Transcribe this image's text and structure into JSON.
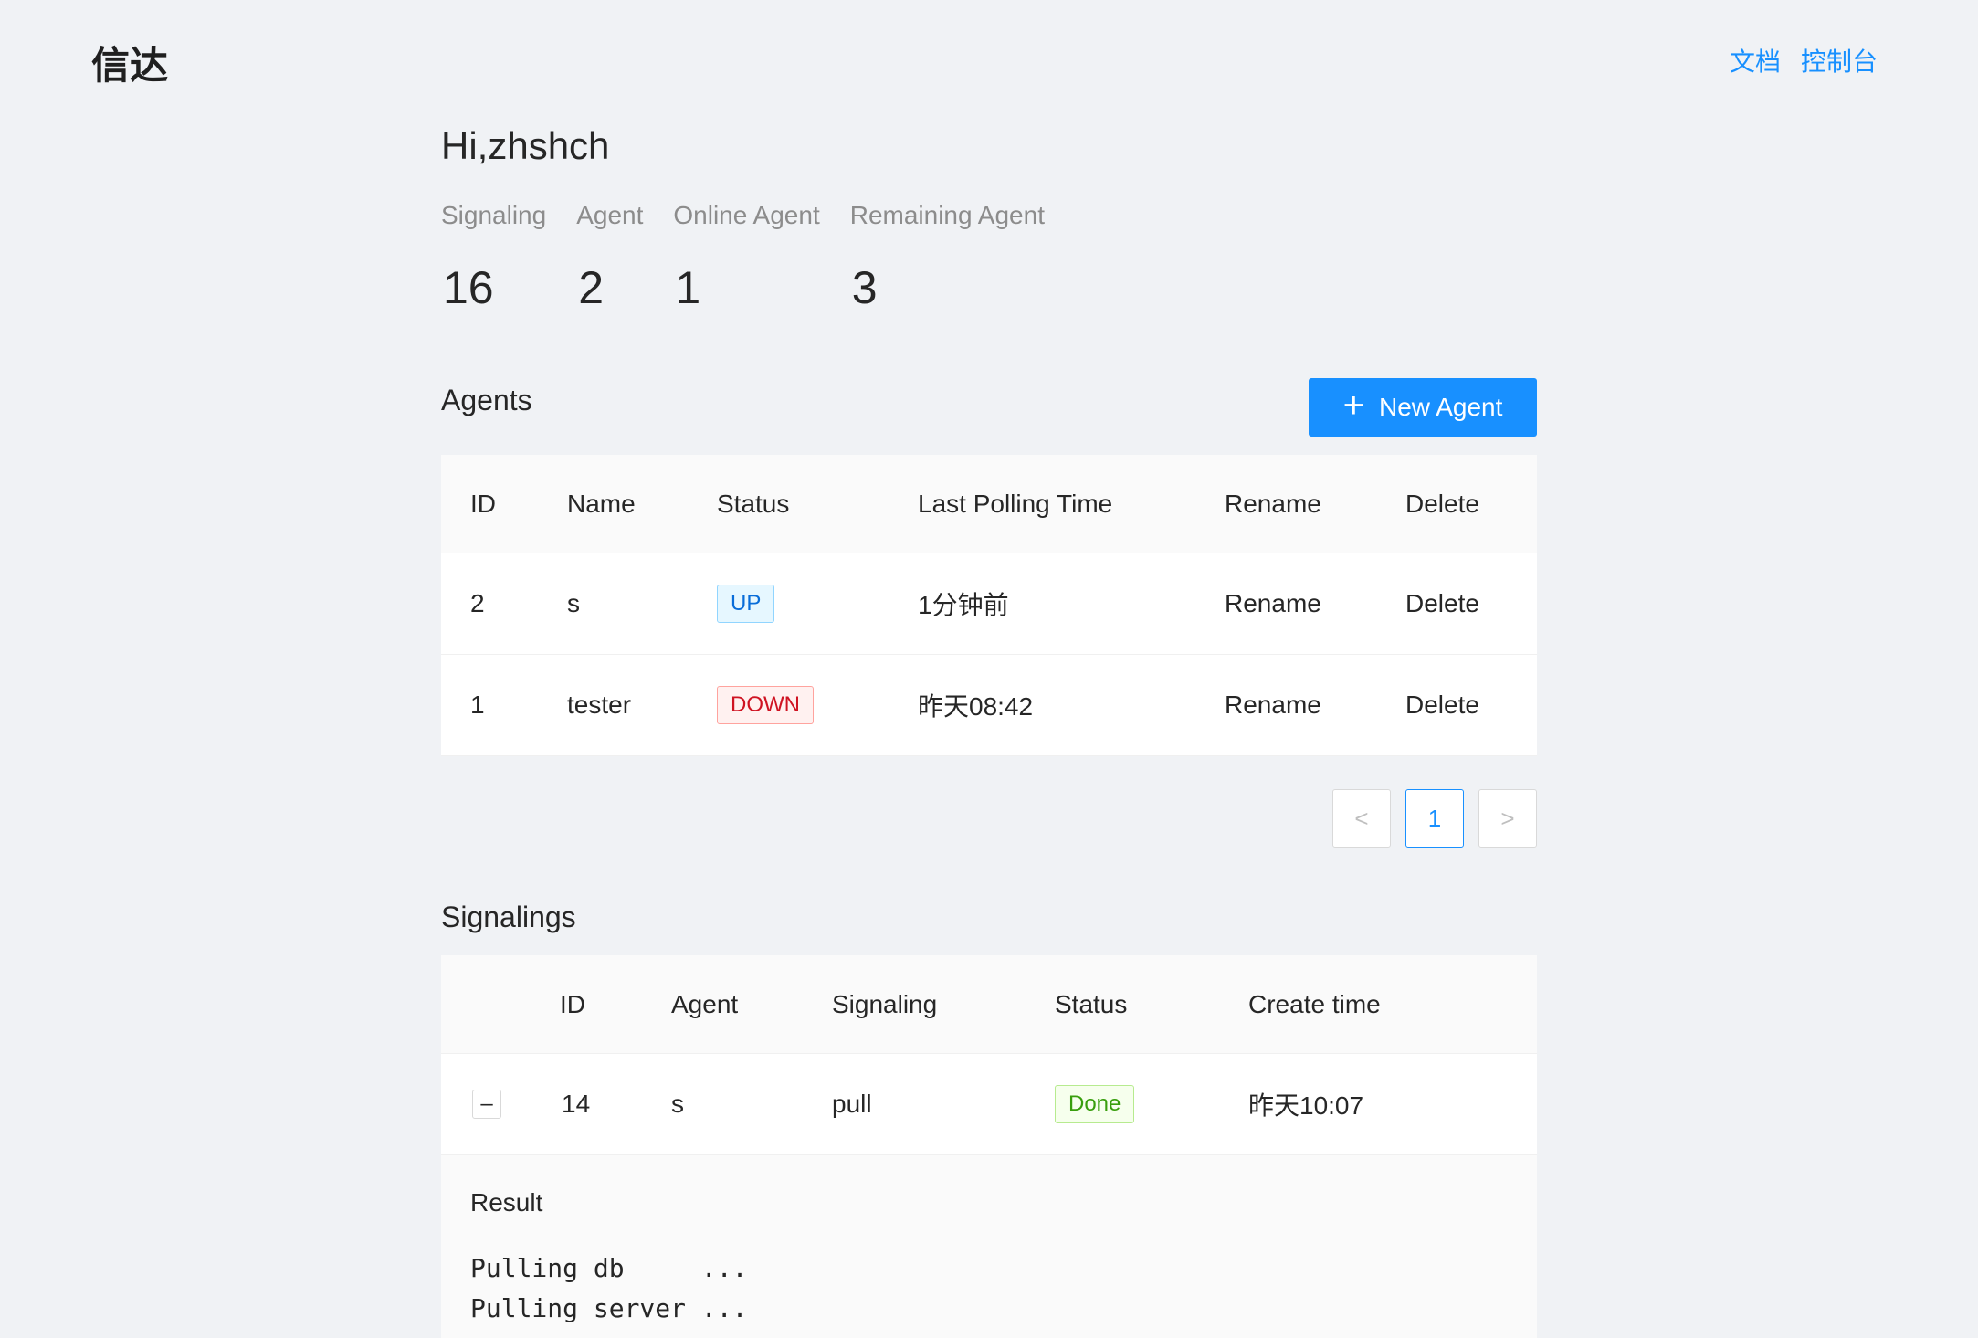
{
  "header": {
    "brand": "信达",
    "nav": [
      "文档",
      "控制台"
    ]
  },
  "greeting": "Hi,zhshch",
  "stats": [
    {
      "label": "Signaling",
      "value": "16"
    },
    {
      "label": "Agent",
      "value": "2"
    },
    {
      "label": "Online Agent",
      "value": "1"
    },
    {
      "label": "Remaining Agent",
      "value": "3"
    }
  ],
  "agents": {
    "title": "Agents",
    "new_button": "New Agent",
    "columns": [
      "ID",
      "Name",
      "Status",
      "Last Polling Time",
      "Rename",
      "Delete"
    ],
    "rows": [
      {
        "id": "2",
        "name": "s",
        "status": "UP",
        "last_polling": "1分钟前",
        "rename": "Rename",
        "delete": "Delete"
      },
      {
        "id": "1",
        "name": "tester",
        "status": "DOWN",
        "last_polling": "昨天08:42",
        "rename": "Rename",
        "delete": "Delete"
      }
    ],
    "pagination": {
      "prev": "<",
      "current": "1",
      "next": ">"
    }
  },
  "signalings": {
    "title": "Signalings",
    "columns": [
      "ID",
      "Agent",
      "Signaling",
      "Status",
      "Create time"
    ],
    "rows": [
      {
        "expand": "–",
        "id": "14",
        "agent": "s",
        "signaling": "pull",
        "status": "Done",
        "create_time": "昨天10:07"
      }
    ],
    "expanded": {
      "label": "Result",
      "lines": "Pulling db     ...\nPulling server ..."
    }
  },
  "colors": {
    "primary": "#1890ff",
    "up": "#096dd9",
    "down": "#cf1322",
    "done": "#389e0d"
  }
}
